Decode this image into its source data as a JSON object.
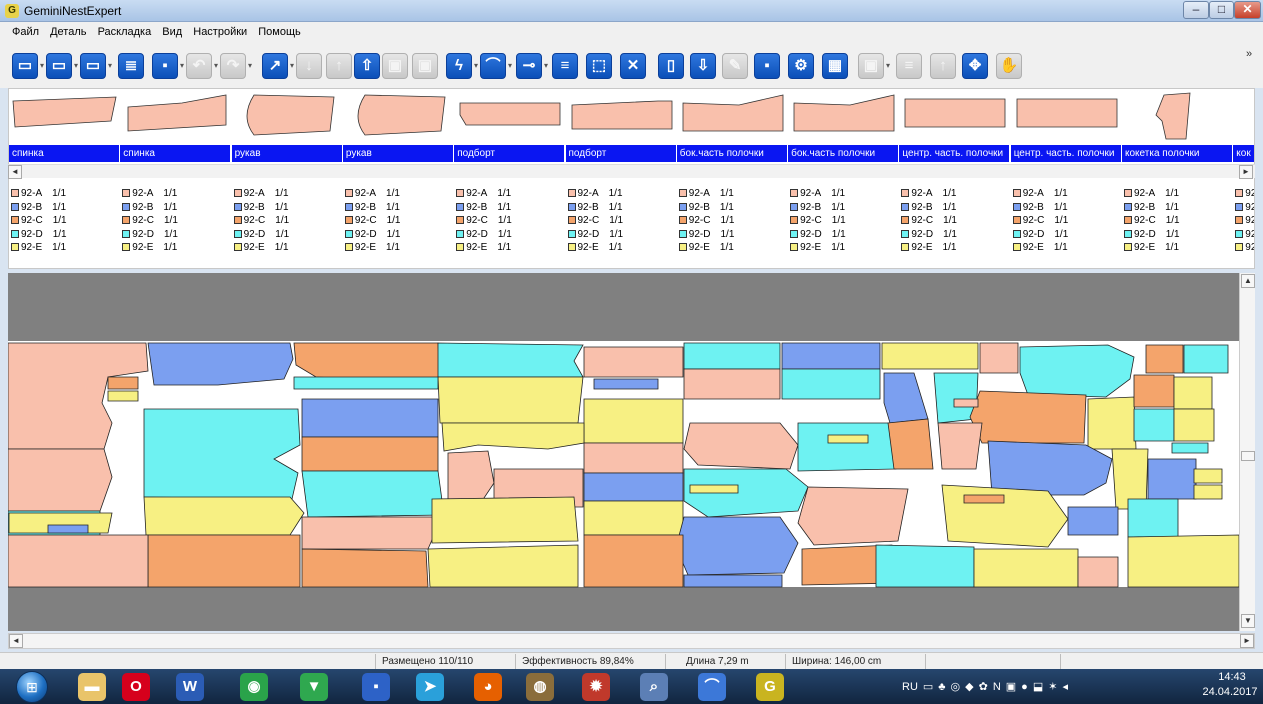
{
  "window": {
    "title": "GeminiNestExpert",
    "app_icon": "G",
    "minimize": "–",
    "maximize": "□",
    "close": "✕"
  },
  "menu": [
    "Файл",
    "Деталь",
    "Раскладка",
    "Вид",
    "Настройки",
    "Помощь"
  ],
  "toolbar": {
    "buttons": [
      {
        "icon": "open-folder-icon",
        "glyph": "▭",
        "enabled": true,
        "dropdown": true
      },
      {
        "icon": "open-folder-icon",
        "glyph": "▭",
        "enabled": true,
        "dropdown": true
      },
      {
        "icon": "export-folder-icon",
        "glyph": "▭",
        "enabled": true,
        "dropdown": true
      },
      {
        "icon": "list-icon",
        "glyph": "≣",
        "enabled": true,
        "dropdown": false
      },
      {
        "icon": "save-icon",
        "glyph": "▪",
        "enabled": true,
        "dropdown": true
      },
      {
        "icon": "undo-icon",
        "glyph": "↶",
        "enabled": false,
        "dropdown": true
      },
      {
        "icon": "redo-icon",
        "glyph": "↷",
        "enabled": false,
        "dropdown": true
      },
      {
        "icon": "arrow-icon",
        "glyph": "↗",
        "enabled": true,
        "dropdown": true
      },
      {
        "icon": "down-arrow-icon",
        "glyph": "↓",
        "enabled": false,
        "dropdown": false
      },
      {
        "icon": "up-arrow-icon",
        "glyph": "↑",
        "enabled": false,
        "dropdown": false
      },
      {
        "icon": "piece-up-icon",
        "glyph": "⇧",
        "enabled": true,
        "dropdown": false
      },
      {
        "icon": "piece-lock-icon",
        "glyph": "▣",
        "enabled": false,
        "dropdown": false
      },
      {
        "icon": "piece-lock-icon",
        "glyph": "▣",
        "enabled": false,
        "dropdown": false
      },
      {
        "icon": "lightning-icon",
        "glyph": "ϟ",
        "enabled": true,
        "dropdown": true
      },
      {
        "icon": "curve-icon",
        "glyph": "⌒",
        "enabled": true,
        "dropdown": true
      },
      {
        "icon": "connect-icon",
        "glyph": "⊸",
        "enabled": true,
        "dropdown": true
      },
      {
        "icon": "align-icon",
        "glyph": "≡",
        "enabled": true,
        "dropdown": false
      },
      {
        "icon": "select-area-icon",
        "glyph": "⬚",
        "enabled": true,
        "dropdown": false
      },
      {
        "icon": "delete-icon",
        "glyph": "✕",
        "enabled": true,
        "dropdown": false
      },
      {
        "icon": "piece-icon",
        "glyph": "▯",
        "enabled": true,
        "dropdown": false
      },
      {
        "icon": "piece-down-icon",
        "glyph": "⇩",
        "enabled": true,
        "dropdown": false
      },
      {
        "icon": "pen-icon",
        "glyph": "✎",
        "enabled": false,
        "dropdown": false
      },
      {
        "icon": "save-icon",
        "glyph": "▪",
        "enabled": true,
        "dropdown": false
      },
      {
        "icon": "wrench-icon",
        "glyph": "⚙",
        "enabled": true,
        "dropdown": false
      },
      {
        "icon": "grid-icon",
        "glyph": "▦",
        "enabled": true,
        "dropdown": false
      },
      {
        "icon": "piece-copy-icon",
        "glyph": "▣",
        "enabled": false,
        "dropdown": true
      },
      {
        "icon": "piece-list-icon",
        "glyph": "≡",
        "enabled": false,
        "dropdown": false
      },
      {
        "icon": "piece-up-icon",
        "glyph": "↑",
        "enabled": false,
        "dropdown": false
      },
      {
        "icon": "move-icon",
        "glyph": "✥",
        "enabled": true,
        "dropdown": false
      },
      {
        "icon": "grab-icon",
        "glyph": "✋",
        "enabled": false,
        "dropdown": false
      }
    ],
    "more": "»"
  },
  "pieces": [
    {
      "name": "спинка",
      "shape": "back"
    },
    {
      "name": "спинка",
      "shape": "back2"
    },
    {
      "name": "рукав",
      "shape": "sleeve"
    },
    {
      "name": "рукав",
      "shape": "sleeve"
    },
    {
      "name": "подборт",
      "shape": "rect"
    },
    {
      "name": "подборт",
      "shape": "rect2"
    },
    {
      "name": "бок.часть полочки",
      "shape": "side"
    },
    {
      "name": "бок.часть полочки",
      "shape": "side"
    },
    {
      "name": "центр. часть. полочки",
      "shape": "rectwide"
    },
    {
      "name": "центр. часть. полочки",
      "shape": "rectwide"
    },
    {
      "name": "кокетка полочки",
      "shape": "yoke"
    },
    {
      "name": "кок",
      "shape": "none"
    }
  ],
  "sizes": [
    {
      "label": "92-A",
      "qty": "1/1",
      "color": "#f9c0ac"
    },
    {
      "label": "92-B",
      "qty": "1/1",
      "color": "#7b9ff0"
    },
    {
      "label": "92-C",
      "qty": "1/1",
      "color": "#f4a46b"
    },
    {
      "label": "92-D",
      "qty": "1/1",
      "color": "#6ef2f2"
    },
    {
      "label": "92-E",
      "qty": "1/1",
      "color": "#f7f083"
    }
  ],
  "scroll": {
    "left": "◄",
    "right": "►",
    "up": "▲",
    "down": "▼"
  },
  "status": {
    "placed": "Размещено 110/110",
    "efficiency": "Эффективность 89,84%",
    "length": "Длина 7,29 m",
    "width": "Ширина: 146,00 cm"
  },
  "taskbar": {
    "apps": [
      {
        "icon": "file-explorer-icon",
        "glyph": "▬",
        "color": "#e9c46a"
      },
      {
        "icon": "opera-icon",
        "glyph": "O",
        "color": "#d6001c"
      },
      {
        "icon": "word-icon",
        "glyph": "W",
        "color": "#2b5cb5"
      },
      {
        "icon": "chrome-icon",
        "glyph": "◉",
        "color": "#2aa34a"
      },
      {
        "icon": "app-triangle-icon",
        "glyph": "▼",
        "color": "#2fa84f"
      },
      {
        "icon": "floppy-icon",
        "glyph": "▪",
        "color": "#2d62c7"
      },
      {
        "icon": "telegram-icon",
        "glyph": "➤",
        "color": "#2aa0da"
      },
      {
        "icon": "firefox-icon",
        "glyph": "◕",
        "color": "#e66000"
      },
      {
        "icon": "app-globe-icon",
        "glyph": "◍",
        "color": "#8a6d3b"
      },
      {
        "icon": "app-fire-icon",
        "glyph": "✹",
        "color": "#c0392b"
      },
      {
        "icon": "app-magnifier-icon",
        "glyph": "⌕",
        "color": "#5c7fb5"
      },
      {
        "icon": "app-curve-icon",
        "glyph": "⌒",
        "color": "#3c78d8"
      },
      {
        "icon": "gemini-icon",
        "glyph": "G",
        "color": "#c9b420"
      }
    ],
    "tray_lang": "RU",
    "tray_icons": [
      "▭",
      "♣",
      "◎",
      "◆",
      "✿",
      "N",
      "▣",
      "●",
      "⬓",
      "✶",
      "◂"
    ],
    "time": "14:43",
    "date": "24.04.2017"
  }
}
